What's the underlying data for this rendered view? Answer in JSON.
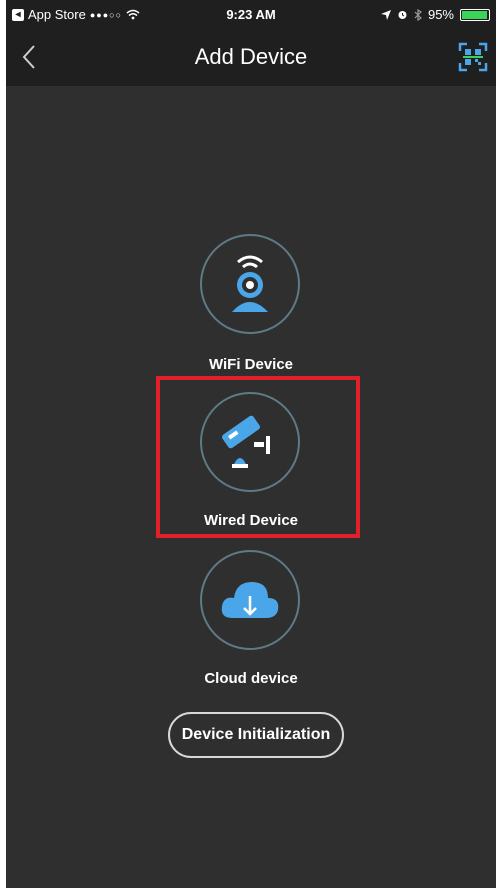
{
  "status_bar": {
    "carrier": "App Store",
    "signal": "●●●○○",
    "time": "9:23 AM",
    "battery_percent": "95%",
    "battery_level": 0.95
  },
  "nav": {
    "title": "Add Device",
    "back_icon": "chevron-left-icon",
    "scan_icon": "qr-scan-icon"
  },
  "devices": [
    {
      "label": "WiFi Device",
      "icon": "wifi-camera-icon"
    },
    {
      "label": "Wired Device",
      "icon": "wired-camera-icon",
      "highlighted": true
    },
    {
      "label": "Cloud device",
      "icon": "cloud-download-icon"
    }
  ],
  "init_button": {
    "label": "Device Initialization"
  },
  "colors": {
    "background": "#2f2f2f",
    "bar": "#1f1f1f",
    "accent": "#4aa6e8",
    "highlight": "#e02228",
    "battery": "#3bd35a"
  }
}
